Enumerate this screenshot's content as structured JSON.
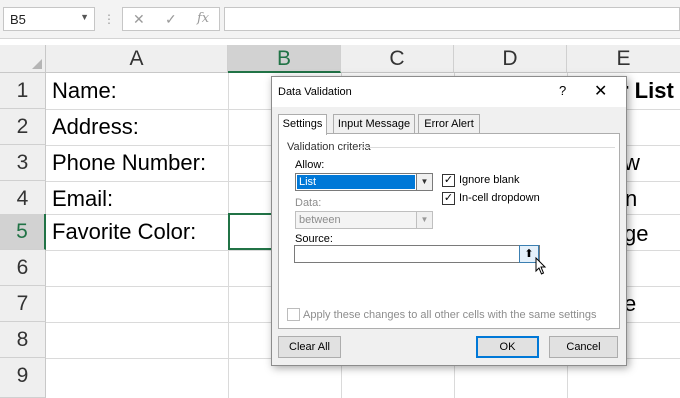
{
  "formula_bar": {
    "name_box": "B5",
    "cancel_glyph": "✕",
    "enter_glyph": "✓",
    "function_glyph": "fx",
    "formula_value": ""
  },
  "columns": [
    "A",
    "B",
    "C",
    "D",
    "E"
  ],
  "rows": [
    "1",
    "2",
    "3",
    "4",
    "5",
    "6",
    "7",
    "8",
    "9"
  ],
  "cells": {
    "a1": "Name:",
    "a2": "Address:",
    "a3": "Phone Number:",
    "a4": "Email:",
    "a5": "Favorite Color:",
    "e1": "r List",
    "e3": "w",
    "e4": "n",
    "e5": "ge",
    "e7": "e"
  },
  "dialog": {
    "title": "Data Validation",
    "help": "?",
    "close": "✕",
    "tabs": [
      "Settings",
      "Input Message",
      "Error Alert"
    ],
    "active_tab": "Settings",
    "group_title": "Validation criteria",
    "allow_label": "Allow:",
    "allow_value": "List",
    "data_label": "Data:",
    "data_value": "between",
    "ignore_blank_label": "Ignore blank",
    "ignore_blank_checked": true,
    "in_cell_dropdown_label": "In-cell dropdown",
    "in_cell_dropdown_checked": true,
    "source_label": "Source:",
    "source_value": "",
    "apply_all_label": "Apply these changes to all other cells with the same settings",
    "clear_all_label": "Clear All",
    "ok_label": "OK",
    "cancel_label": "Cancel",
    "check_glyph": "✓",
    "dropdown_glyph": "▼",
    "collapse_glyph": "⬆"
  },
  "colors": {
    "accent": "#217346",
    "selection_blue": "#0078d7"
  }
}
